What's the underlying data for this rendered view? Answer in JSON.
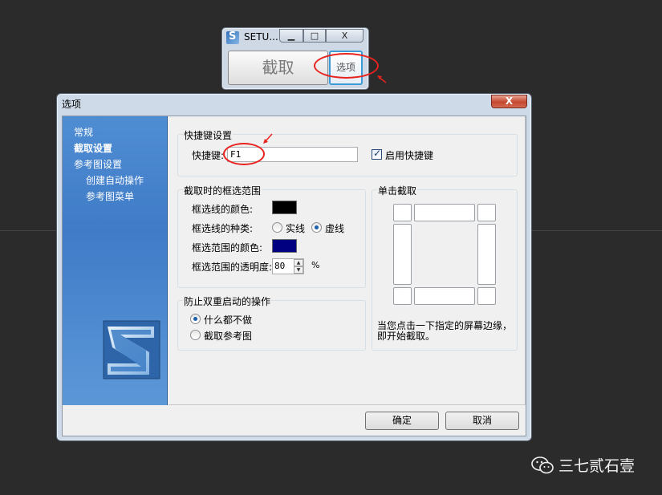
{
  "mini_window": {
    "title": "SETU...",
    "min_glyph": "▁",
    "max_glyph": "□",
    "close_glyph": "X",
    "capture_label": "截取",
    "options_label": "选项"
  },
  "dialog": {
    "title": "选项",
    "close_glyph": "X",
    "sidebar": {
      "items": [
        "常规",
        "截取设置",
        "参考图设置",
        "创建自动操作",
        "参考图菜单"
      ],
      "selected": "截取设置"
    },
    "hotkey_group": {
      "title": "快捷键设置",
      "hotkey_label": "快捷键:",
      "hotkey_value": "F1",
      "enable_label": "启用快捷键",
      "enable_checked": true
    },
    "range_group": {
      "title": "截取时的框选范围",
      "line_color_label": "框选线的颜色:",
      "line_color": "#000000",
      "line_type_label": "框选线的种类:",
      "solid_label": "实线",
      "dashed_label": "虚线",
      "line_type_selected": "虚线",
      "fill_color_label": "框选范围的颜色:",
      "fill_color": "#000080",
      "opacity_label": "框选范围的透明度:",
      "opacity_value": "80",
      "opacity_unit": "%"
    },
    "prevent_group": {
      "title": "防止双重启动的操作",
      "options": [
        "什么都不做",
        "截取参考图"
      ],
      "selected": "什么都不做"
    },
    "click_group": {
      "title": "单击截取",
      "description_line1": "当您点击一下指定的屏幕边缘，",
      "description_line2": "即开始截取。"
    },
    "ok_label": "确定",
    "cancel_label": "取消"
  },
  "watermark": {
    "text": "三七贰石壹",
    "icon": "wechat-icon"
  },
  "colors": {
    "desktop": "#2b2b2c",
    "annotation_red": "#e8231e",
    "sidebar_blue": "#4f8dd3"
  }
}
